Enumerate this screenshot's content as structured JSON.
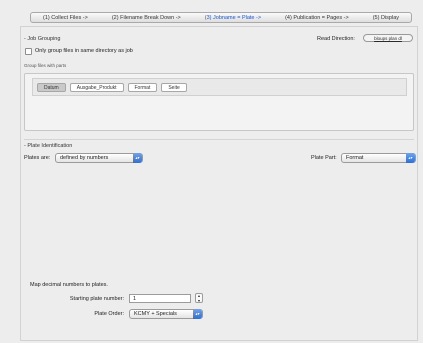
{
  "tabs": [
    {
      "label": "(1) Collect Files ->"
    },
    {
      "label": "(2) Filename Break Down ->"
    },
    {
      "label": "(3) Jobname = Plate ->"
    },
    {
      "label": "(4) Publication = Pages ->"
    },
    {
      "label": "(5) Display"
    }
  ],
  "job_grouping": {
    "title": "- Job Grouping",
    "read_direction_label": "Read Direction:",
    "read_direction_button": "bloups plan dl",
    "only_group_checkbox_label": "Only group files in same directory as job",
    "only_group_checked": false,
    "group_files_label": "Group files with parts",
    "parts": [
      "Datum",
      "Ausgabe_Produkt",
      "Format",
      "Seite"
    ],
    "selected_part": "Datum"
  },
  "plate_identification": {
    "title": "- Plate Identification",
    "plates_are_label": "Plates are:",
    "plates_are_value": "defined by numbers",
    "plate_part_label": "Plate Part:",
    "plate_part_value": "Format"
  },
  "mapping": {
    "title": "Map decimal numbers to plates.",
    "starting_label": "Starting plate number:",
    "starting_value": "1",
    "order_label": "Plate Order:",
    "order_value": "KCMY + Specials"
  }
}
